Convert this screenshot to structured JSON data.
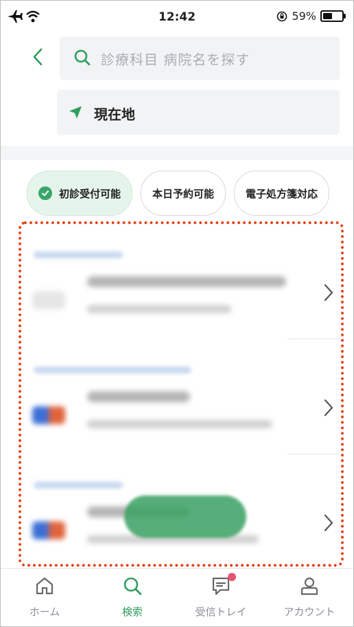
{
  "status_bar": {
    "time": "12:42",
    "battery": "59%",
    "battery_level": 0.59
  },
  "search": {
    "placeholder": "診療科目 病院名を探す"
  },
  "location": {
    "label": "現在地"
  },
  "filters": [
    {
      "label": "初診受付可能",
      "active": true
    },
    {
      "label": "本日予約可能",
      "active": false
    },
    {
      "label": "電子処方箋対応",
      "active": false
    }
  ],
  "nav": {
    "home": "ホーム",
    "search": "検索",
    "inbox": "受信トレイ",
    "account": "アカウント"
  },
  "colors": {
    "accent": "#2e9e5e",
    "highlight_border": "#e4461b",
    "badge": "#e5566e"
  }
}
